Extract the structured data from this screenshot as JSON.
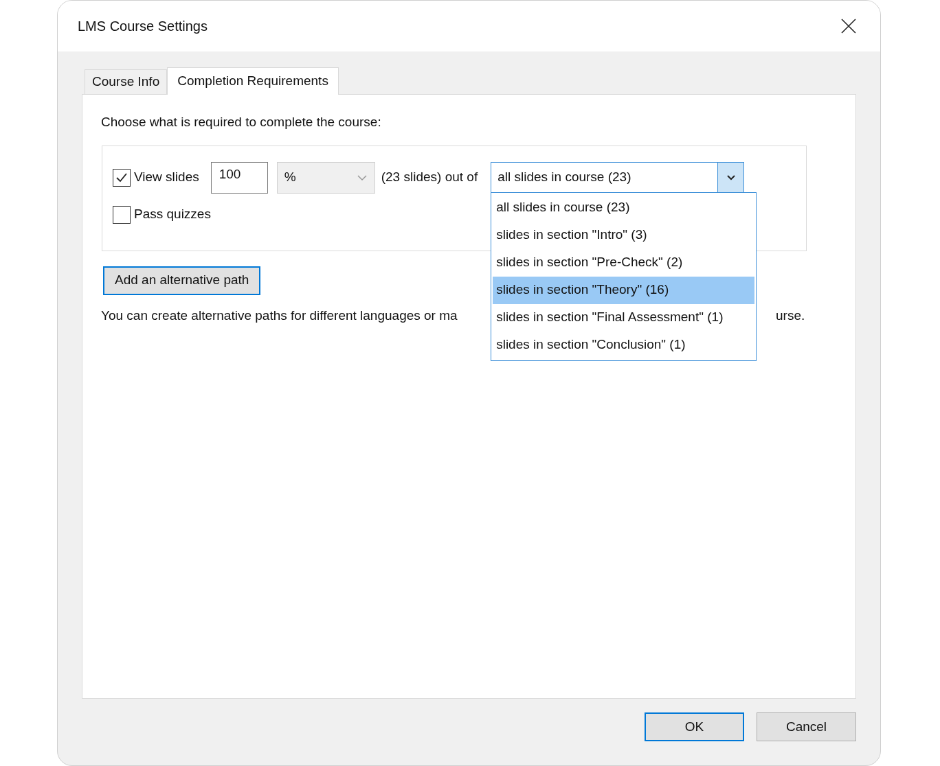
{
  "window": {
    "title": "LMS Course Settings"
  },
  "tabs": [
    {
      "label": "Course Info",
      "selected": false
    },
    {
      "label": "Completion Requirements",
      "selected": true
    }
  ],
  "prompt": "Choose what is required to complete the course:",
  "requirements": [
    {
      "kind": "view_slides",
      "label": "View slides",
      "checked": true,
      "amount": "100",
      "unit": "%",
      "count_text": "(23 slides) out of",
      "scope": {
        "value": "all slides in course (23)",
        "expanded": true,
        "options": [
          {
            "label": "all slides in course (23)",
            "highlighted": false
          },
          {
            "label": "slides in section \"Intro\" (3)",
            "highlighted": false
          },
          {
            "label": "slides in section \"Pre-Check\" (2)",
            "highlighted": false
          },
          {
            "label": "slides in section \"Theory\" (16)",
            "highlighted": true
          },
          {
            "label": "slides in section \"Final Assessment\" (1)",
            "highlighted": false
          },
          {
            "label": "slides in section \"Conclusion\" (1)",
            "highlighted": false
          }
        ]
      }
    },
    {
      "kind": "pass_quizzes",
      "label": "Pass quizzes",
      "checked": false
    }
  ],
  "add_path_button": "Add an alternative path",
  "hint": {
    "before": "You can create alternative paths for different languages or ma",
    "after": "urse."
  },
  "buttons": [
    {
      "label": "OK",
      "default": true
    },
    {
      "label": "Cancel",
      "default": false
    }
  ]
}
